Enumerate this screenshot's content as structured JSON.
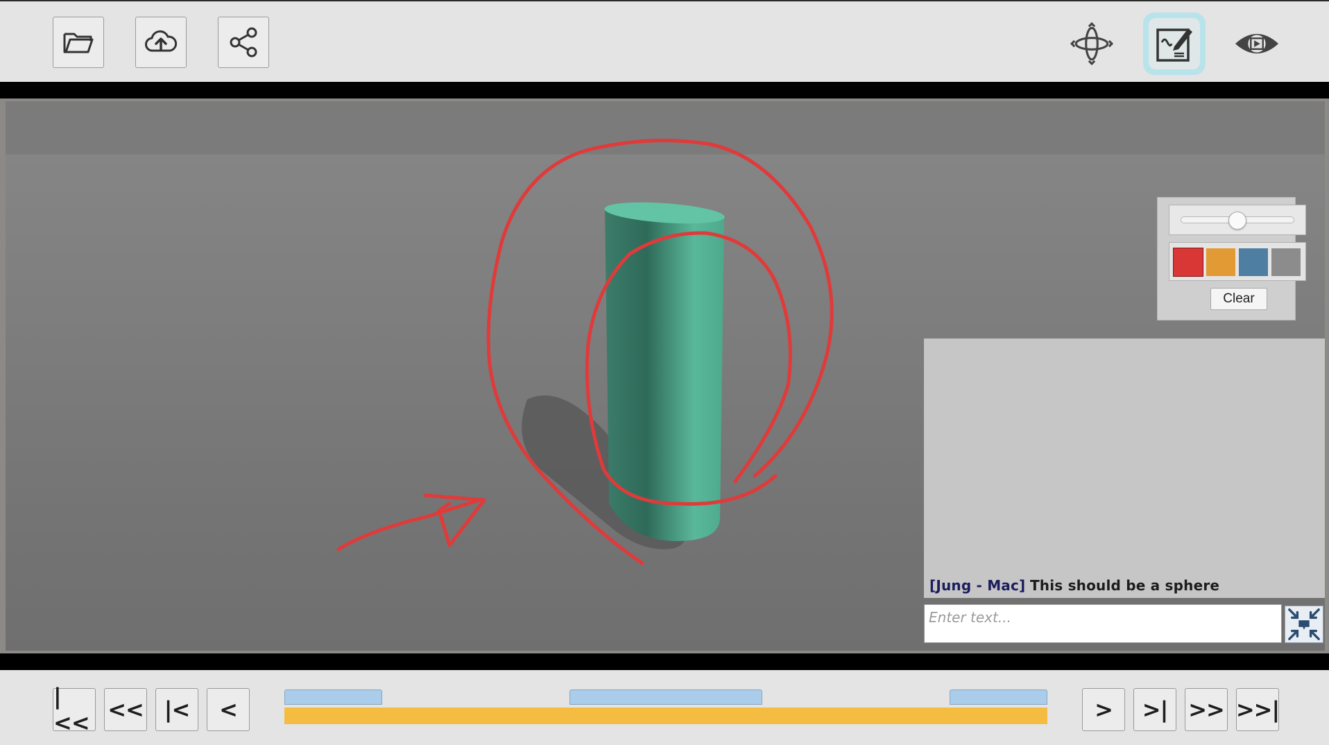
{
  "toolbar": {
    "left_buttons": [
      {
        "name": "open-folder-button",
        "icon": "folder-open-icon"
      },
      {
        "name": "cloud-upload-button",
        "icon": "cloud-upload-icon"
      },
      {
        "name": "share-button",
        "icon": "share-icon"
      }
    ],
    "mode_buttons": [
      {
        "name": "orbit-mode-button",
        "icon": "orbit-arrows-icon",
        "active": false
      },
      {
        "name": "annotate-mode-button",
        "icon": "edit-note-icon",
        "active": true,
        "highlight_color": "#b9e3ea"
      },
      {
        "name": "view-mode-button",
        "icon": "eye-play-icon",
        "active": false
      }
    ]
  },
  "scene": {
    "object": "cylinder",
    "object_color": "#5bbf9e",
    "annotation_color": "#e03a3a",
    "annotations": [
      "large-circle",
      "inner-circle",
      "arrow"
    ]
  },
  "draw_panel": {
    "brush_size": 0.5,
    "colors": [
      {
        "name": "red",
        "hex": "#d93636"
      },
      {
        "name": "orange",
        "hex": "#e29a34"
      },
      {
        "name": "blue",
        "hex": "#4e7fa3"
      },
      {
        "name": "gray",
        "hex": "#8c8c8c"
      }
    ],
    "selected_color": "red",
    "clear_label": "Clear"
  },
  "chat": {
    "messages": [
      {
        "author": "[Jung - Mac]",
        "text": "This should be a sphere"
      }
    ],
    "input_placeholder": "Enter text...",
    "collapse_icon": "collapse-arrows-icon"
  },
  "playback": {
    "left_buttons": [
      "|<<",
      "<<",
      "|<",
      "<"
    ],
    "right_buttons": [
      ">",
      ">|",
      ">>",
      ">>|"
    ],
    "timeline": {
      "track_color": "#f4bd41",
      "segment_color": "#a9cdea",
      "segments": [
        {
          "start": 0.0,
          "end": 0.128
        },
        {
          "start": 0.374,
          "end": 0.626
        },
        {
          "start": 0.872,
          "end": 1.0
        }
      ]
    }
  }
}
